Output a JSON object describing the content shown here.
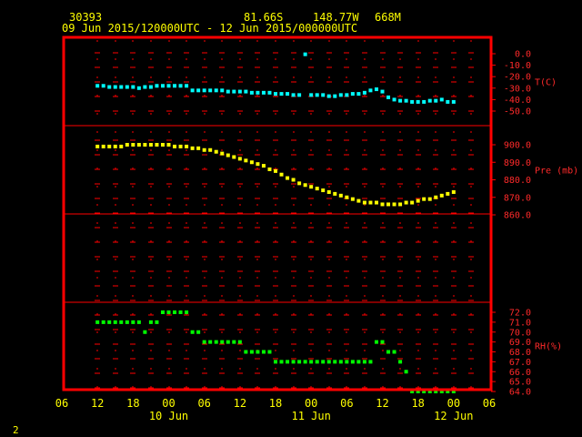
{
  "header": {
    "station_id": "30393",
    "lat": "81.66S",
    "lon": "148.77W",
    "elev": "668M",
    "date_range": "09 Jun 2015/120000UTC - 12 Jun 2015/000000UTC"
  },
  "page_number": "2",
  "chart_data": [
    {
      "type": "scatter",
      "panel": "temperature",
      "ylabel": "T(C)",
      "yticks": [
        "0.0",
        "-10.0",
        "-20.0",
        "-30.0",
        "-40.0",
        "-50.0"
      ],
      "ylim": [
        -50,
        0
      ],
      "color": "#00ffff",
      "x_hours": [
        12,
        13,
        14,
        15,
        16,
        17,
        18,
        19,
        20,
        21,
        22,
        23,
        24,
        25,
        26,
        27,
        28,
        29,
        30,
        31,
        32,
        33,
        34,
        35,
        36,
        37,
        38,
        39,
        40,
        41,
        42,
        43,
        44,
        45,
        46,
        47,
        48,
        49,
        50,
        51,
        52,
        53,
        54,
        55,
        56,
        57,
        58,
        59,
        60,
        61,
        62,
        63,
        64,
        65,
        66,
        67,
        68,
        69,
        70,
        71,
        72
      ],
      "values": [
        -28,
        -28,
        -29,
        -29,
        -29,
        -29,
        -29,
        -30,
        -29,
        -29,
        -28,
        -28,
        -28,
        -28,
        -28,
        -28,
        -32,
        -32,
        -32,
        -32,
        -32,
        -32,
        -33,
        -33,
        -33,
        -33,
        -34,
        -34,
        -34,
        -34,
        -35,
        -35,
        -35,
        -36,
        -36,
        -0.5,
        -36,
        -36,
        -36,
        -37,
        -37,
        -36,
        -36,
        -35,
        -35,
        -34,
        -32,
        -31,
        -33,
        -38,
        -40,
        -41,
        -41,
        -42,
        -42,
        -42,
        -41,
        -41,
        -40,
        -42,
        -42
      ]
    },
    {
      "type": "scatter",
      "panel": "pressure",
      "ylabel": "Pre (mb)",
      "yticks": [
        "900.0",
        "890.0",
        "880.0",
        "870.0",
        "860.0"
      ],
      "ylim": [
        855,
        905
      ],
      "color": "#ffff00",
      "x_hours": [
        12,
        13,
        14,
        15,
        16,
        17,
        18,
        19,
        20,
        21,
        22,
        23,
        24,
        25,
        26,
        27,
        28,
        29,
        30,
        31,
        32,
        33,
        34,
        35,
        36,
        37,
        38,
        39,
        40,
        41,
        42,
        43,
        44,
        45,
        46,
        47,
        48,
        49,
        50,
        51,
        52,
        53,
        54,
        55,
        56,
        57,
        58,
        59,
        60,
        61,
        62,
        63,
        64,
        65,
        66,
        67,
        68,
        69,
        70,
        71,
        72
      ],
      "values": [
        899,
        899,
        899,
        899,
        899,
        900,
        900,
        900,
        900,
        900,
        900,
        900,
        900,
        899,
        899,
        899,
        898,
        898,
        897,
        897,
        896,
        895,
        894,
        893,
        892,
        891,
        890,
        889,
        888,
        886,
        885,
        883,
        881,
        880,
        878,
        877,
        876,
        875,
        874,
        873,
        872,
        871,
        870,
        869,
        868,
        867,
        867,
        867,
        866,
        866,
        866,
        866,
        867,
        867,
        868,
        869,
        869,
        870,
        871,
        872,
        873
      ]
    },
    {
      "type": "scatter",
      "panel": "relative_humidity",
      "ylabel": "RH(%)",
      "yticks": [
        "72.0",
        "71.0",
        "70.0",
        "69.0",
        "68.0",
        "67.0",
        "66.0",
        "65.0",
        "64.0"
      ],
      "ylim": [
        64,
        72
      ],
      "color": "#00ff00",
      "x_hours": [
        12,
        13,
        14,
        15,
        16,
        17,
        18,
        19,
        20,
        21,
        22,
        23,
        24,
        25,
        26,
        27,
        28,
        29,
        30,
        31,
        32,
        33,
        34,
        35,
        36,
        37,
        38,
        39,
        40,
        41,
        42,
        43,
        44,
        45,
        46,
        47,
        48,
        49,
        50,
        51,
        52,
        53,
        54,
        55,
        56,
        57,
        58,
        59,
        60,
        61,
        62,
        63,
        64,
        65,
        66,
        67,
        68,
        69,
        70,
        71,
        72
      ],
      "values": [
        71,
        71,
        71,
        71,
        71,
        71,
        71,
        71,
        70,
        71,
        71,
        72,
        72,
        72,
        72,
        72,
        70,
        70,
        69,
        69,
        69,
        69,
        69,
        69,
        69,
        68,
        68,
        68,
        68,
        68,
        67,
        67,
        67,
        67,
        67,
        67,
        67,
        67,
        67,
        67,
        67,
        67,
        67,
        67,
        67,
        67,
        67,
        69,
        69,
        68,
        68,
        67,
        66,
        64,
        64,
        64,
        64,
        64,
        64,
        64,
        64
      ]
    }
  ],
  "x_axis": {
    "hour_labels": [
      "06",
      "12",
      "18",
      "00",
      "06",
      "12",
      "18",
      "00",
      "06",
      "12",
      "18",
      "00",
      "06"
    ],
    "hours": [
      6,
      12,
      18,
      24,
      30,
      36,
      42,
      48,
      54,
      60,
      66,
      72,
      78
    ],
    "day_labels": [
      {
        "text": "10 Jun",
        "hour": 24
      },
      {
        "text": "11 Jun",
        "hour": 48
      },
      {
        "text": "12 Jun",
        "hour": 72
      }
    ]
  },
  "colors": {
    "background": "#000000",
    "frame": "#ff0000",
    "header_text": "#ffff00",
    "tick_labels": "#ff2a2a",
    "temperature": "#00ffff",
    "pressure": "#ffff00",
    "humidity": "#00ff00"
  }
}
